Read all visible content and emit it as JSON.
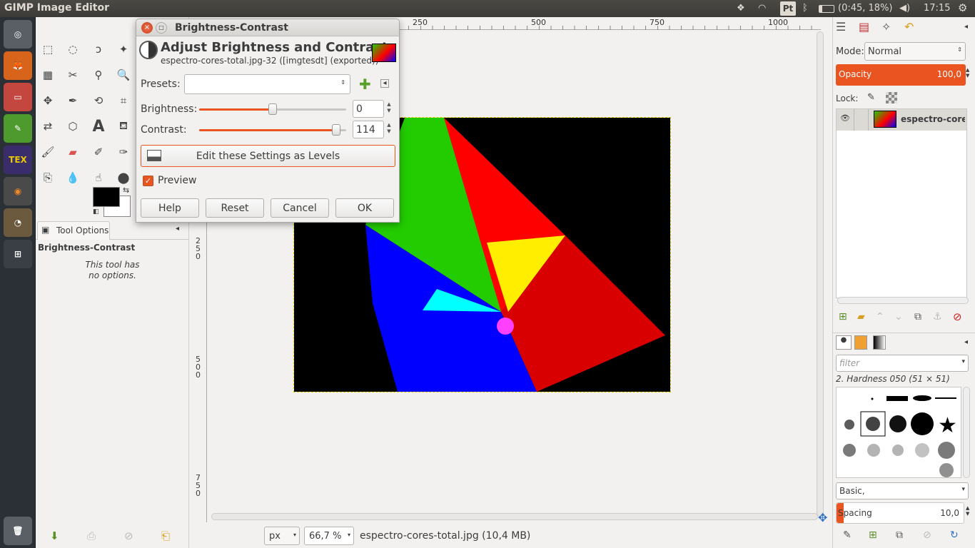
{
  "topbar": {
    "app_title": "GIMP Image Editor",
    "input_method": "Pt",
    "battery": "(0:45, 18%)",
    "time": "17:15"
  },
  "toolbox": {
    "tool_options_tab": "Tool Options",
    "active_tool": "Brightness-Contrast",
    "no_options_line1": "This tool has",
    "no_options_line2": "no options."
  },
  "canvas": {
    "ruler_top": [
      "250",
      "500",
      "750",
      "1000"
    ],
    "ruler_left_250": [
      "2",
      "5",
      "0"
    ],
    "ruler_left_500": [
      "5",
      "0",
      "0"
    ],
    "ruler_left_750": [
      "7",
      "5",
      "0"
    ],
    "unit": "px",
    "zoom": "66,7 %",
    "status": "espectro-cores-total.jpg (10,4 MB)"
  },
  "dialog": {
    "title": "Brightness-Contrast",
    "heading": "Adjust Brightness and Contrast",
    "subheading": "espectro-cores-total.jpg-32 ([imgtesdt] (exported))",
    "presets_label": "Presets:",
    "presets_value": "",
    "brightness_label": "Brightness:",
    "brightness_value": "0",
    "brightness_fraction": 0.5,
    "contrast_label": "Contrast:",
    "contrast_value": "114",
    "contrast_fraction": 0.93,
    "levels_button": "Edit these Settings as Levels",
    "preview_label": "Preview",
    "preview_checked": true,
    "help": "Help",
    "reset": "Reset",
    "cancel": "Cancel",
    "ok": "OK"
  },
  "layers": {
    "mode_label": "Mode:",
    "mode_value": "Normal",
    "opacity_label": "Opacity",
    "opacity_value": "100,0",
    "lock_label": "Lock:",
    "layer_name": "espectro-cores-te"
  },
  "brushes": {
    "filter_placeholder": "filter",
    "brush_name": "2. Hardness 050 (51 × 51)",
    "tag": "Basic,",
    "spacing_label": "Spacing",
    "spacing_value": "10,0"
  },
  "colors": {
    "accent": "#e95420",
    "fg": "#000000",
    "bg": "#ffffff"
  }
}
